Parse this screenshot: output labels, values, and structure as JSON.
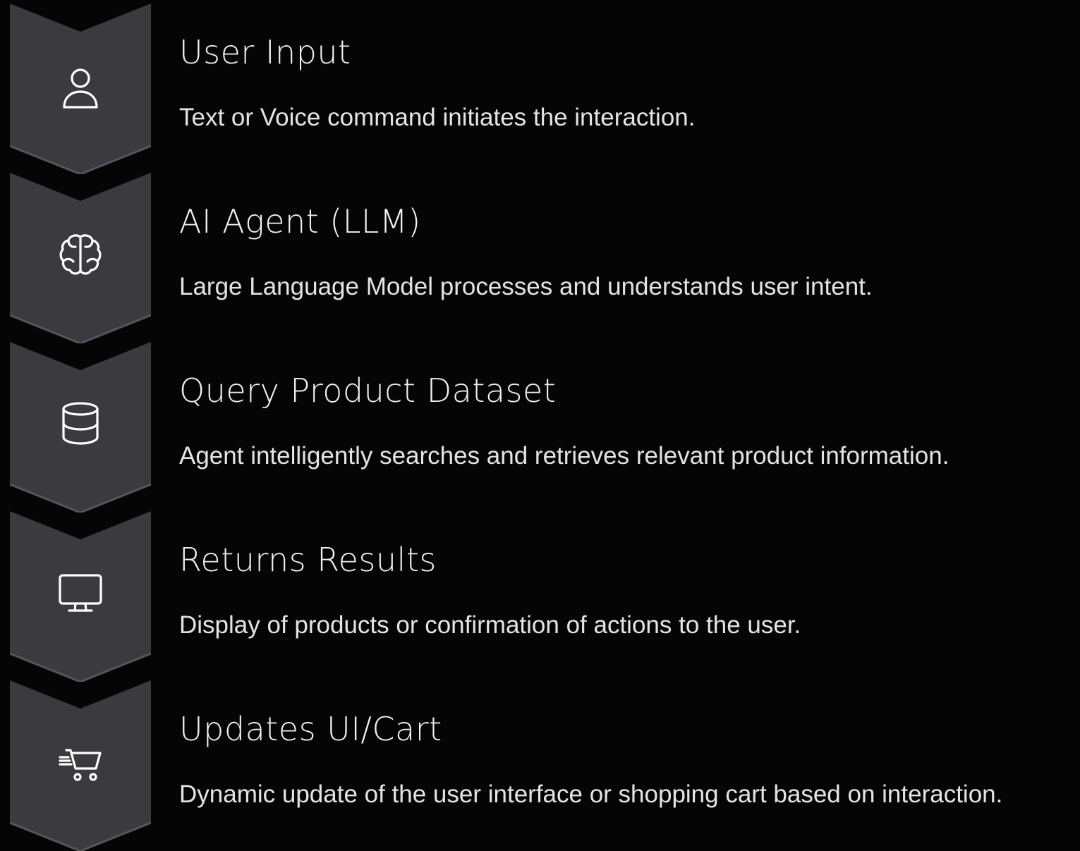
{
  "steps": [
    {
      "icon": "user-icon",
      "title": "User Input",
      "description": "Text or Voice command initiates the interaction."
    },
    {
      "icon": "brain-icon",
      "title": "AI Agent (LLM)",
      "description": "Large Language Model processes and understands user intent."
    },
    {
      "icon": "database-icon",
      "title": "Query Product Dataset",
      "description": "Agent intelligently searches and retrieves relevant product information."
    },
    {
      "icon": "monitor-icon",
      "title": "Returns Results",
      "description": "Display of products or confirmation of actions to the user."
    },
    {
      "icon": "shopping-cart-icon",
      "title": "Updates UI/Cart",
      "description": "Dynamic update of the user interface or shopping cart based on interaction."
    }
  ],
  "colors": {
    "background": "#050505",
    "chevron_fill": "#3b3b3f",
    "chevron_edge": "#56565b",
    "icon_stroke": "#ffffff",
    "text": "#f2f2f2"
  }
}
